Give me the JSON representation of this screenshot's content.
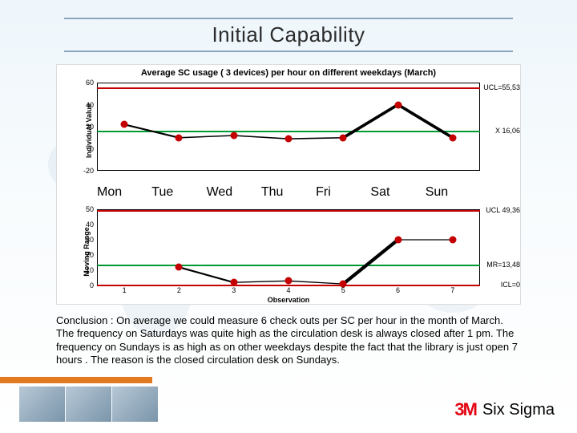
{
  "title": "Initial Capability",
  "chart_data": [
    {
      "type": "line",
      "title": "Average SC usage ( 3 devices) per hour on different weekdays (March)",
      "ylabel": "Individual Value",
      "xlabel": "",
      "ylim": [
        -20,
        60
      ],
      "yticks": [
        -20,
        0,
        20,
        40,
        60
      ],
      "categories": [
        "Mon",
        "Tue",
        "Wed",
        "Thu",
        "Fri",
        "Sat",
        "Sun"
      ],
      "series": [
        {
          "name": "Individual",
          "values": [
            22,
            10,
            12,
            9,
            10,
            40,
            10
          ]
        }
      ],
      "reference_lines": [
        {
          "label": "UCL=55,53",
          "value": 55.53,
          "color": "red"
        },
        {
          "label": "X  16,06",
          "value": 16.06,
          "color": "green"
        }
      ]
    },
    {
      "type": "line",
      "title": "",
      "ylabel": "Moving Range",
      "xlabel": "Observation",
      "ylim": [
        0,
        50
      ],
      "yticks": [
        0,
        10,
        20,
        30,
        40,
        50
      ],
      "categories": [
        "1",
        "2",
        "3",
        "4",
        "5",
        "6",
        "7"
      ],
      "series": [
        {
          "name": "MR",
          "values": [
            null,
            12,
            2,
            3,
            1,
            30,
            30
          ]
        }
      ],
      "reference_lines": [
        {
          "label": "UCL 49,36",
          "value": 49.36,
          "color": "red"
        },
        {
          "label": "MR=13,48",
          "value": 13.48,
          "color": "green"
        },
        {
          "label": "ICL=0",
          "value": 0,
          "color": "red"
        }
      ]
    }
  ],
  "days": [
    "Mon",
    "Tue",
    "Wed",
    "Thu",
    "Fri",
    "Sat",
    "Sun"
  ],
  "bottom_ticks": [
    "1",
    "2",
    "3",
    "4",
    "5",
    "6",
    "7"
  ],
  "conclusion": "Conclusion : On average we could measure 6 check outs per SC per hour in the month of March.  The frequency on Saturdays was quite high as the circulation desk is always closed after 1 pm. The frequency on Sundays is as high as on other weekdays despite the fact that the library is just open 7 hours . The reason is the closed circulation desk on Sundays.",
  "footer": {
    "brand_glyph": "3M",
    "program": "Six Sigma"
  }
}
